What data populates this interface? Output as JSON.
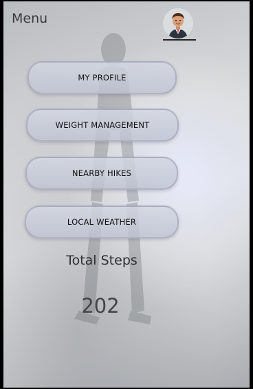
{
  "header": {
    "menu_label": "Menu",
    "avatar_icon": "user-avatar-icon"
  },
  "menu": {
    "items": [
      {
        "label": "MY PROFILE"
      },
      {
        "label": "WEIGHT MANAGEMENT"
      },
      {
        "label": "NEARBY HIKES"
      },
      {
        "label": "LOCAL WEATHER"
      }
    ]
  },
  "steps": {
    "label": "Total Steps",
    "value": "202"
  },
  "colors": {
    "button_fill": "#cfd3df",
    "button_border": "#9696af",
    "text_dark": "#111111"
  }
}
